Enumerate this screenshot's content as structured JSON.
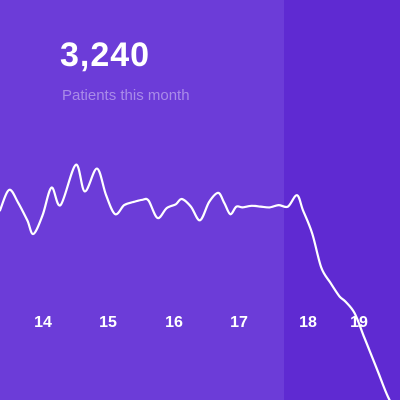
{
  "stat": {
    "value": "3,240",
    "label": "Patients this month"
  },
  "colors": {
    "background": "#6c3cd8",
    "highlight": "#5f2ad2",
    "line": "#ffffff",
    "label": "#a98be8"
  },
  "chart_data": {
    "type": "line",
    "title": "",
    "xlabel": "",
    "ylabel": "",
    "tick_labels": [
      "14",
      "15",
      "16",
      "17",
      "18",
      "19"
    ],
    "x": [
      13.0,
      13.15,
      13.3,
      13.45,
      13.55,
      13.7,
      13.85,
      14.0,
      14.25,
      14.4,
      14.6,
      14.75,
      14.9,
      15.05,
      15.2,
      15.35,
      15.45,
      15.6,
      15.75,
      15.9,
      16.0,
      16.15,
      16.3,
      16.45,
      16.6,
      16.7,
      16.8,
      16.9,
      17.0,
      17.15,
      17.3,
      17.45,
      17.6,
      17.75,
      17.9,
      18.0,
      18.15,
      18.3,
      18.45,
      18.6,
      18.7,
      18.85,
      19.0,
      19.1,
      19.25,
      19.4,
      19.6
    ],
    "values": [
      0.35,
      0.62,
      0.45,
      0.22,
      0.04,
      0.28,
      0.65,
      0.42,
      0.95,
      0.6,
      0.9,
      0.55,
      0.3,
      0.42,
      0.46,
      0.49,
      0.48,
      0.25,
      0.38,
      0.43,
      0.5,
      0.4,
      0.22,
      0.46,
      0.58,
      0.45,
      0.3,
      0.4,
      0.39,
      0.41,
      0.4,
      0.39,
      0.42,
      0.4,
      0.55,
      0.35,
      0.05,
      -0.4,
      -0.6,
      -0.78,
      -0.85,
      -1.0,
      -1.3,
      -1.5,
      -1.8,
      -2.1,
      -2.4
    ],
    "xlim": [
      13.0,
      19.6
    ],
    "ylim": [
      -1.05,
      1.05
    ],
    "highlight_from_x": 17.7,
    "grid": false,
    "legend": false
  }
}
